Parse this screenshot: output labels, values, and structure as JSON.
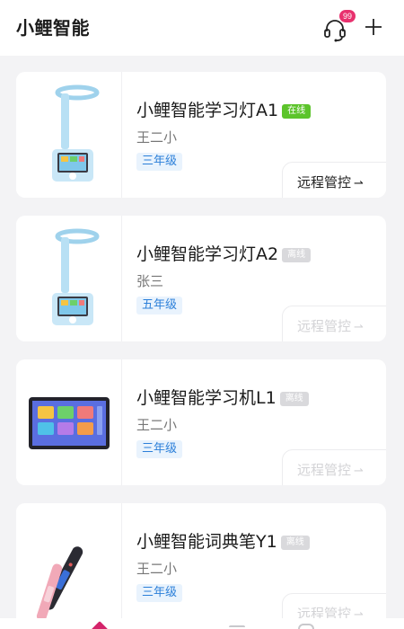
{
  "header": {
    "title": "小鲤智能",
    "support_icon": "headset-icon",
    "support_badge": "99",
    "add_icon": "plus-icon"
  },
  "colors": {
    "accent": "#e8316e",
    "online": "#5cc42b",
    "offline": "#d9d9dc",
    "grade_text": "#2b7fd9",
    "grade_bg": "#e9f3fd",
    "tab_active": "#d4236a"
  },
  "devices": [
    {
      "name": "小鲤智能学习灯A1",
      "status": "在线",
      "online": true,
      "owner": "王二小",
      "grade": "三年级",
      "action": "远程管控",
      "action_icon": "arrow-right-icon",
      "image": "study-lamp"
    },
    {
      "name": "小鲤智能学习灯A2",
      "status": "离线",
      "online": false,
      "owner": "张三",
      "grade": "五年级",
      "action": "远程管控",
      "action_icon": "arrow-right-icon",
      "image": "study-lamp"
    },
    {
      "name": "小鲤智能学习机L1",
      "status": "离线",
      "online": false,
      "owner": "王二小",
      "grade": "三年级",
      "action": "远程管控",
      "action_icon": "arrow-right-icon",
      "image": "learning-tablet"
    },
    {
      "name": "小鲤智能词典笔Y1",
      "status": "离线",
      "online": false,
      "owner": "王二小",
      "grade": "三年级",
      "action": "远程管控",
      "action_icon": "arrow-right-icon",
      "image": "dictionary-pen"
    }
  ],
  "tabbar": {
    "icons": [
      "home-icon",
      "tab-icon",
      "tab-icon"
    ]
  }
}
